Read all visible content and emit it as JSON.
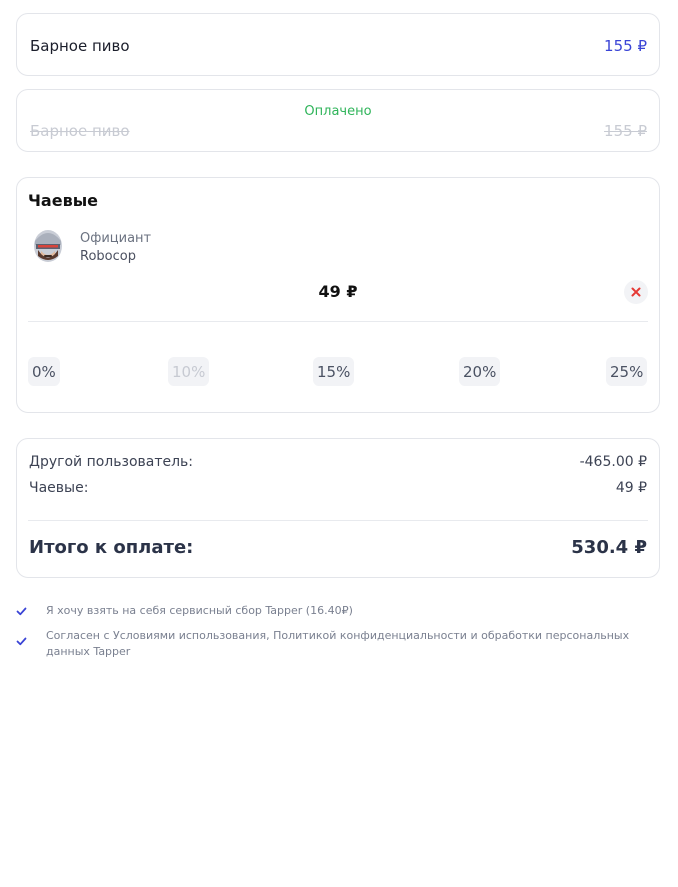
{
  "order_item": {
    "name": "Барное пиво",
    "price": "155 ₽"
  },
  "paid_item": {
    "status": "Оплачено",
    "name": "Барное пиво",
    "price": "155 ₽"
  },
  "tips": {
    "title": "Чаевые",
    "waiter_role": "Официант",
    "waiter_name": "Robocop",
    "amount": "49 ₽",
    "options": [
      {
        "label": "0%",
        "disabled": false
      },
      {
        "label": "10%",
        "disabled": true
      },
      {
        "label": "15%",
        "disabled": false
      },
      {
        "label": "20%",
        "disabled": false
      },
      {
        "label": "25%",
        "disabled": false
      }
    ]
  },
  "summary": {
    "rows": [
      {
        "label": "Другой пользователь:",
        "value": "-465.00 ₽"
      },
      {
        "label": "Чаевые:",
        "value": "49 ₽"
      }
    ],
    "total_label": "Итого к оплате:",
    "total_value": "530.4 ₽"
  },
  "agreements": [
    {
      "text": "Я хочу взять на себя сервисный сбор Tapper (16.40₽)",
      "checked": true
    },
    {
      "text": "Согласен с Условиями использования, Политикой конфиденциальности и обработки персональных данных Tapper",
      "checked": true
    }
  ],
  "colors": {
    "accent_price": "#3a44d6",
    "paid_green": "#2fb45a",
    "check_blue": "#3a44d6",
    "clear_red": "#e53935"
  }
}
